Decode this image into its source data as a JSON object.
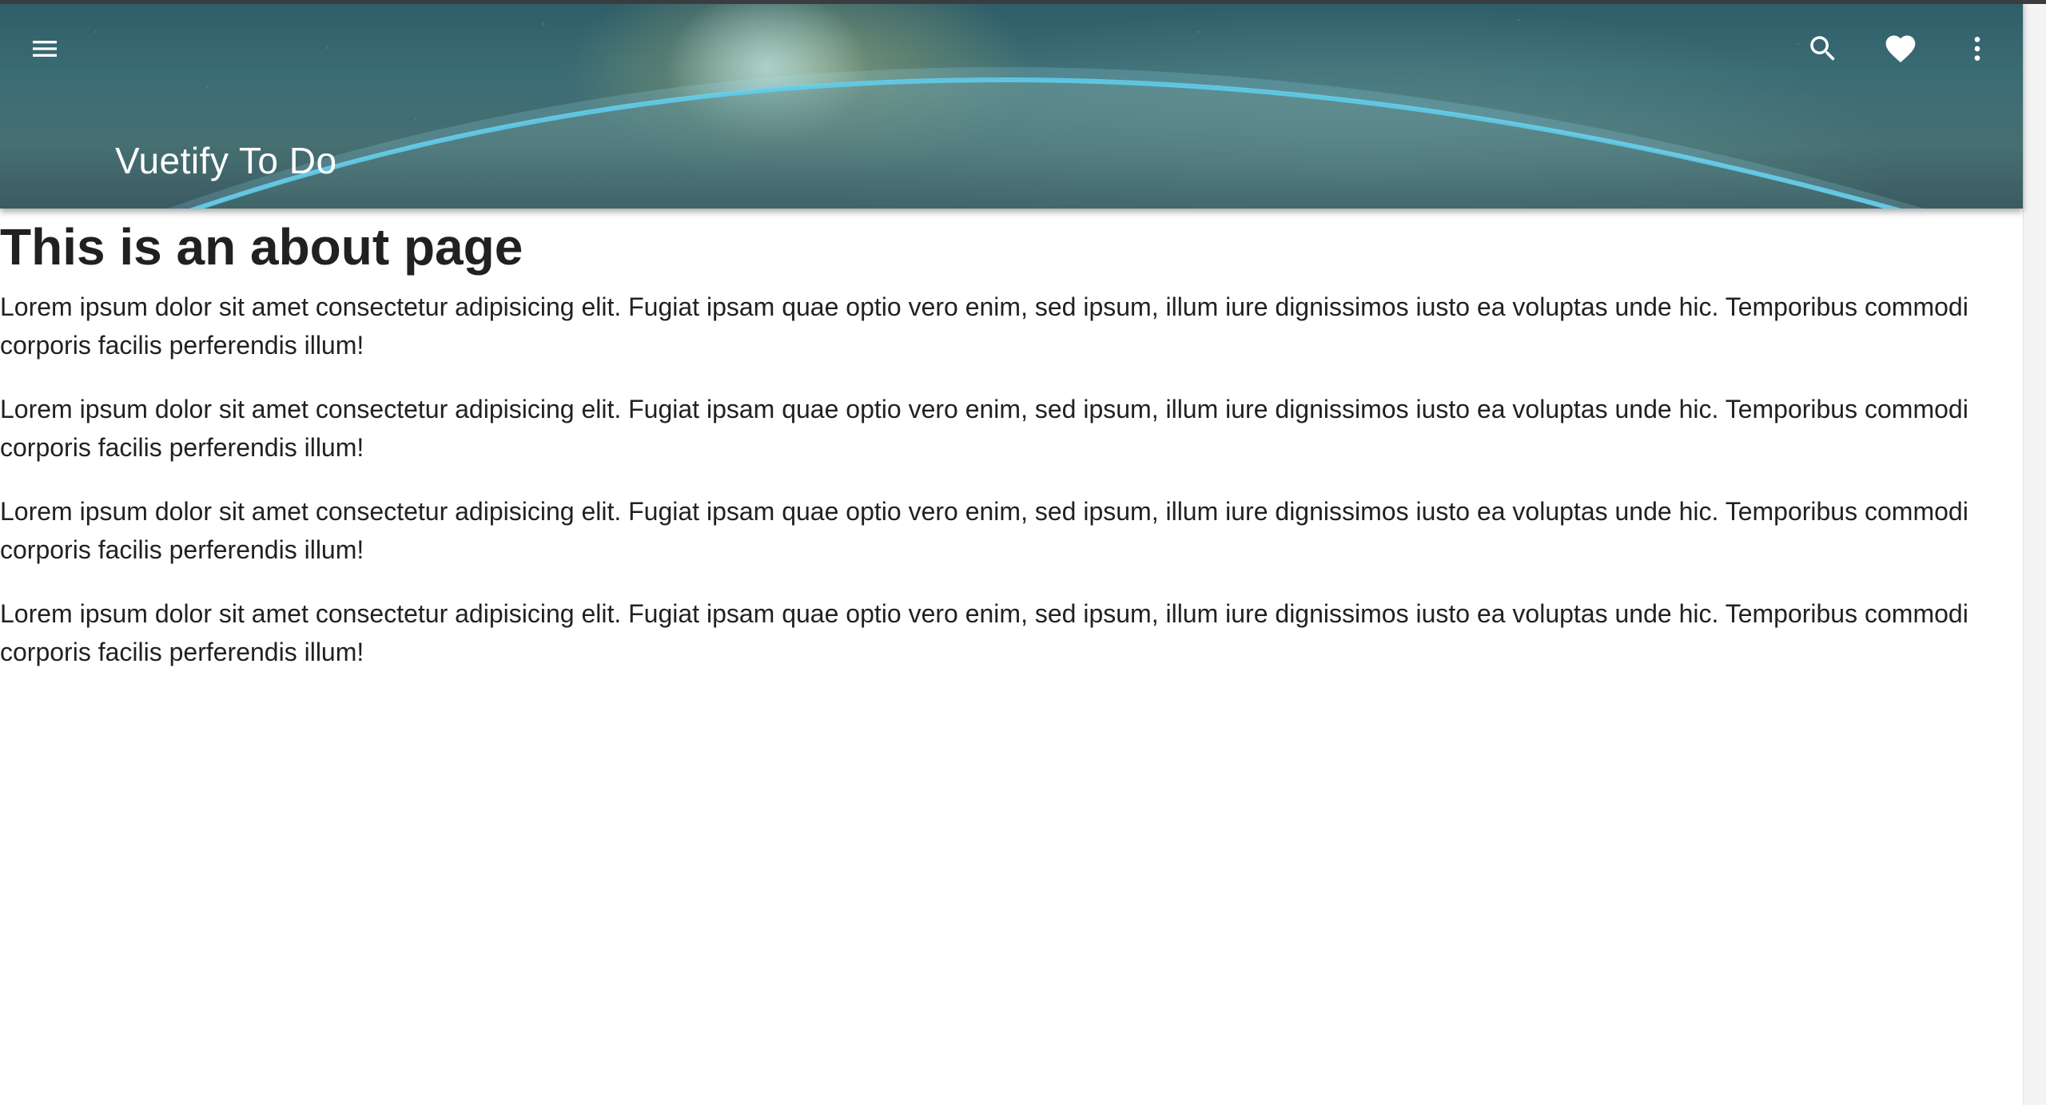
{
  "app_bar": {
    "title": "Vuetify To Do",
    "icons": {
      "menu": "menu-icon",
      "search": "search-icon",
      "favorite": "heart-icon",
      "more": "more-vert-icon"
    }
  },
  "main": {
    "heading": "This is an about page",
    "paragraphs": [
      "Lorem ipsum dolor sit amet consectetur adipisicing elit. Fugiat ipsam quae optio vero enim, sed ipsum, illum iure dignissimos iusto ea voluptas unde hic. Temporibus commodi corporis facilis perferendis illum!",
      "Lorem ipsum dolor sit amet consectetur adipisicing elit. Fugiat ipsam quae optio vero enim, sed ipsum, illum iure dignissimos iusto ea voluptas unde hic. Temporibus commodi corporis facilis perferendis illum!",
      "Lorem ipsum dolor sit amet consectetur adipisicing elit. Fugiat ipsam quae optio vero enim, sed ipsum, illum iure dignissimos iusto ea voluptas unde hic. Temporibus commodi corporis facilis perferendis illum!",
      "Lorem ipsum dolor sit amet consectetur adipisicing elit. Fugiat ipsam quae optio vero enim, sed ipsum, illum iure dignissimos iusto ea voluptas unde hic. Temporibus commodi corporis facilis perferendis illum!"
    ]
  },
  "colors": {
    "app_bar_base": "#3a6c74",
    "text": "#212121",
    "icon": "#ffffff"
  }
}
